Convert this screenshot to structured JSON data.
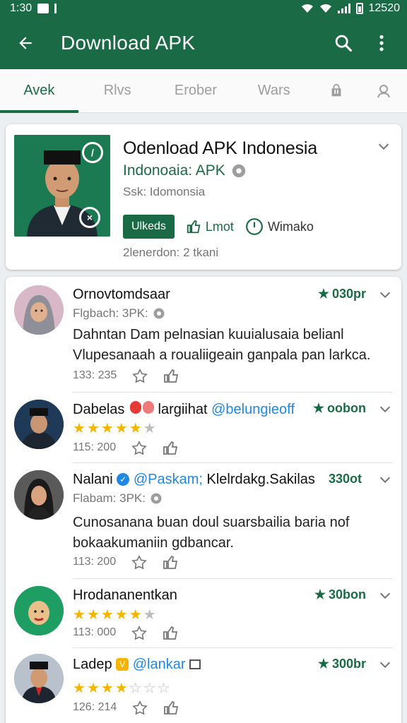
{
  "status": {
    "time": "1:30",
    "right_text": "12520"
  },
  "appbar": {
    "title": "Download APK"
  },
  "tabs": [
    {
      "label": "Avek"
    },
    {
      "label": "Rlvs"
    },
    {
      "label": "Erober"
    },
    {
      "label": "Wars"
    }
  ],
  "hero": {
    "title": "Odenload APK Indonesia",
    "subtitle": "Indonoaia: APK",
    "meta": "Ssk: Idomonsia",
    "primary_button": "Ulkeds",
    "like_label": "Lmot",
    "time_label": "Wimako",
    "footer": "2lenerdon: 2 tkani"
  },
  "items": [
    {
      "name": "Ornovtomdsaar",
      "rating": "030pr",
      "source": "Flgbach: 3PK:",
      "text_line1": "Dahntan Dam pelnasian kuuialusaia belianl",
      "text_line2": "Vlupesanaah a roualiigeain ganpala pan larkca.",
      "count": "133: 235"
    },
    {
      "name": "Dabelas",
      "name_suffix": "largiihat",
      "handle": "@belungieoff",
      "rating": "oobon",
      "stars": 4.5,
      "count": "115: 200"
    },
    {
      "name": "Nalani",
      "handle": "@Paskam;",
      "name_suffix": "Klelrdakg.Sakilas",
      "rating": "330ot",
      "source": "Flabam: 3PK:",
      "text_line1": "Cunosanana buan doul suarsbailia baria nof",
      "text_line2": "bokaakumaniin gdbancar.",
      "count": "113: 200"
    },
    {
      "name": "Hrodananentkan",
      "rating": "30bon",
      "stars": 4.5,
      "count": "113: 000"
    },
    {
      "name": "Ladep",
      "handle": "@lankar",
      "rating": "300br",
      "stars": 4,
      "count": "126: 214"
    }
  ],
  "colors": {
    "primary": "#1a6b45",
    "accent_blue": "#1e88e5",
    "star": "#f4b400"
  }
}
